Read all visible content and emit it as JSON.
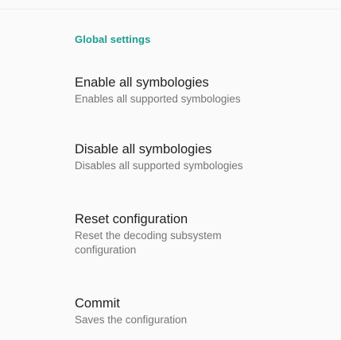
{
  "settings": {
    "category_title": "Global settings",
    "items": [
      {
        "title": "Enable all symbologies",
        "summary": "Enables all supported symbologies"
      },
      {
        "title": "Disable all symbologies",
        "summary": "Disables all supported symbologies"
      },
      {
        "title": "Reset configuration",
        "summary": "Reset the decoding subsystem configuration"
      },
      {
        "title": "Commit",
        "summary": "Saves the configuration"
      }
    ]
  }
}
